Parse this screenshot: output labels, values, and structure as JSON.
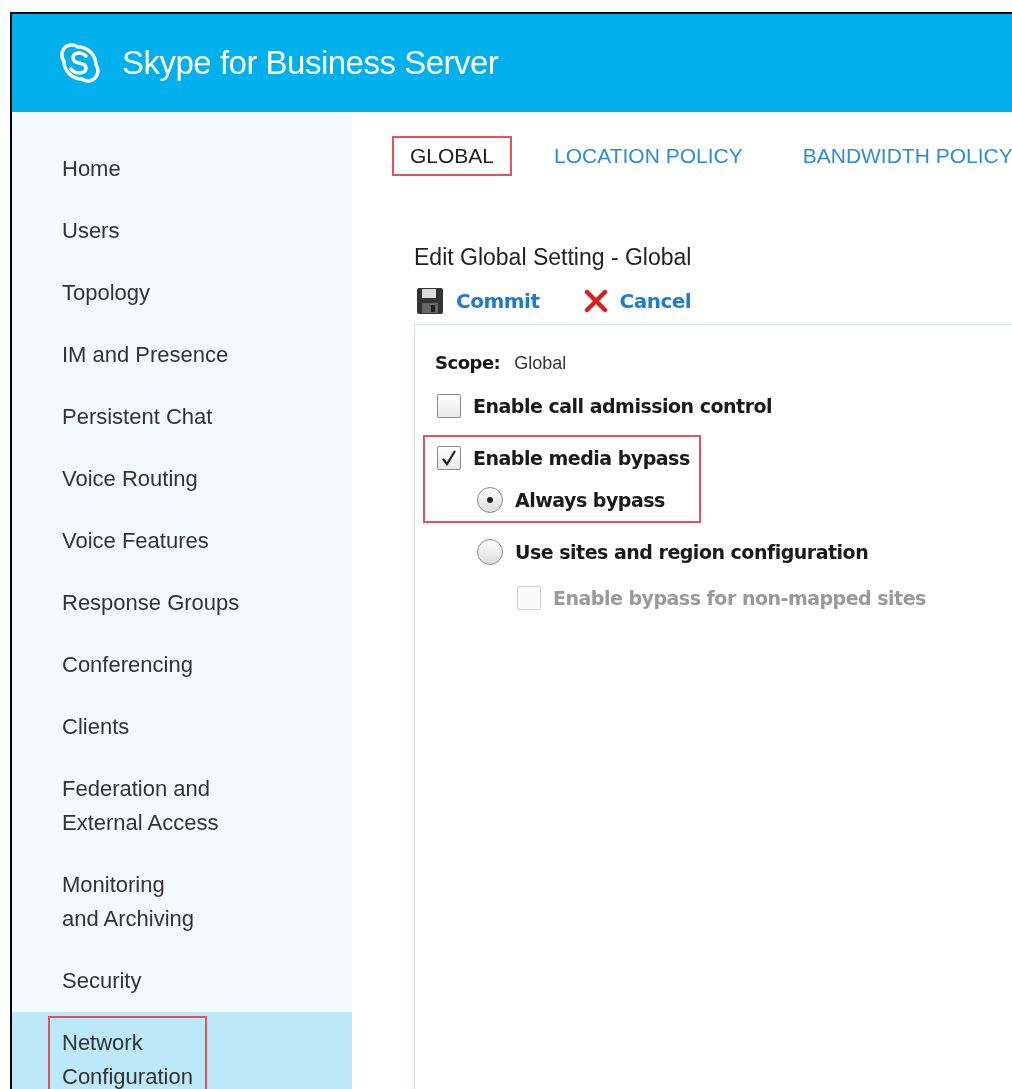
{
  "header": {
    "title": "Skype for Business Server"
  },
  "sidebar": {
    "items": [
      {
        "label": "Home",
        "selected": false,
        "highlighted": false
      },
      {
        "label": "Users",
        "selected": false,
        "highlighted": false
      },
      {
        "label": "Topology",
        "selected": false,
        "highlighted": false
      },
      {
        "label": "IM and Presence",
        "selected": false,
        "highlighted": false
      },
      {
        "label": "Persistent Chat",
        "selected": false,
        "highlighted": false
      },
      {
        "label": "Voice Routing",
        "selected": false,
        "highlighted": false
      },
      {
        "label": "Voice Features",
        "selected": false,
        "highlighted": false
      },
      {
        "label": "Response Groups",
        "selected": false,
        "highlighted": false
      },
      {
        "label": "Conferencing",
        "selected": false,
        "highlighted": false
      },
      {
        "label": "Clients",
        "selected": false,
        "highlighted": false
      },
      {
        "label": "Federation and\nExternal Access",
        "selected": false,
        "highlighted": false
      },
      {
        "label": "Monitoring\nand Archiving",
        "selected": false,
        "highlighted": false
      },
      {
        "label": "Security",
        "selected": false,
        "highlighted": false
      },
      {
        "label": "Network\nConfiguration",
        "selected": true,
        "highlighted": true
      }
    ]
  },
  "tabs": [
    {
      "label": "GLOBAL",
      "selected": true,
      "highlighted": true
    },
    {
      "label": "LOCATION POLICY",
      "selected": false,
      "highlighted": false
    },
    {
      "label": "BANDWIDTH POLICY",
      "selected": false,
      "highlighted": false
    }
  ],
  "page_title": "Edit Global Setting - Global",
  "toolbar": [
    {
      "kind": "save",
      "label": "Commit"
    },
    {
      "kind": "cancel",
      "label": "Cancel"
    }
  ],
  "form": {
    "scope_label": "Scope:",
    "scope_value": "Global",
    "options": [
      {
        "kind": "checkbox",
        "label": "Enable call admission control",
        "checked": false,
        "disabled": false,
        "highlighted": false
      },
      {
        "kind": "checkbox",
        "label": "Enable media bypass",
        "checked": true,
        "disabled": false,
        "highlighted": true,
        "children": [
          {
            "kind": "radio",
            "label": "Always bypass",
            "checked": true,
            "disabled": false,
            "highlighted": true
          },
          {
            "kind": "radio",
            "label": "Use sites and region configuration",
            "checked": false,
            "disabled": false,
            "highlighted": false,
            "children": [
              {
                "kind": "checkbox",
                "label": "Enable bypass for non-mapped sites",
                "checked": false,
                "disabled": true,
                "highlighted": false
              }
            ]
          }
        ]
      }
    ]
  }
}
